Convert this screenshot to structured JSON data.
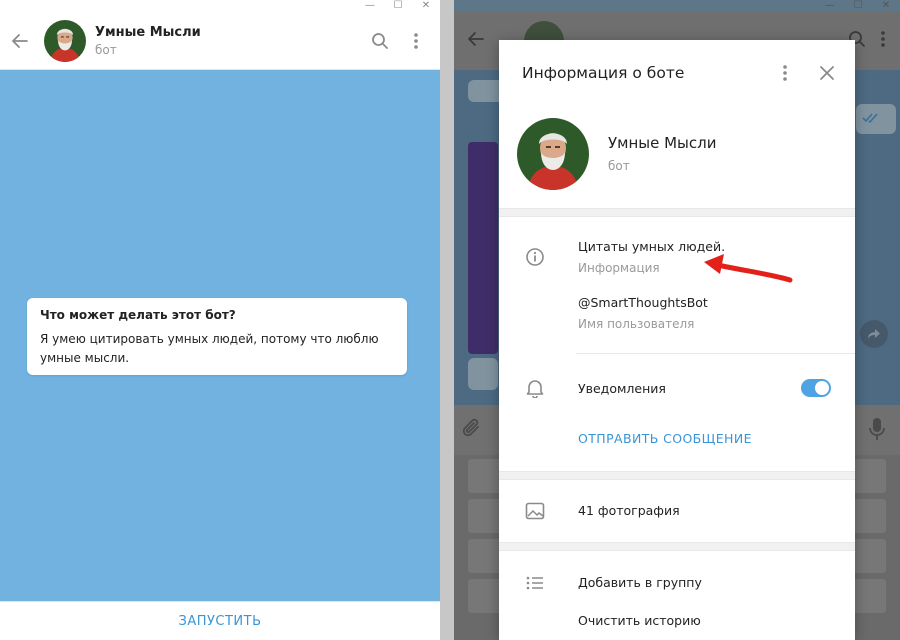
{
  "left_window": {
    "controls": [
      "—",
      "☐",
      "✕"
    ],
    "header": {
      "title": "Умные Мысли",
      "subtitle": "бот"
    },
    "bot_card": {
      "title": "Что может делать этот бот?",
      "text": "Я умею цитировать умных людей, потому что люблю умные мысли."
    },
    "start_button": "ЗАПУСТИТЬ"
  },
  "right_window": {
    "controls": [
      "—",
      "☐",
      "✕"
    ]
  },
  "modal": {
    "title": "Информация о боте",
    "profile": {
      "name": "Умные Мысли",
      "subtitle": "бот"
    },
    "about": {
      "value": "Цитаты умных людей.",
      "label": "Информация"
    },
    "username": {
      "value": "@SmartThoughtsBot",
      "label": "Имя пользователя"
    },
    "notifications": {
      "label": "Уведомления",
      "enabled": true
    },
    "send_message": "ОТПРАВИТЬ СООБЩЕНИЕ",
    "photos": "41 фотография",
    "add_to_group": "Добавить в группу",
    "clear_history": "Очистить историю"
  },
  "colors": {
    "accent": "#3a95d6",
    "chat_background": "#72b2e0",
    "annotation_arrow": "#e3211b"
  },
  "icons": [
    "back-arrow-icon",
    "search-icon",
    "more-vertical-icon",
    "close-icon",
    "info-icon",
    "bell-icon",
    "image-icon",
    "list-icon",
    "paperclip-icon",
    "microphone-icon",
    "share-icon",
    "double-check-icon"
  ]
}
